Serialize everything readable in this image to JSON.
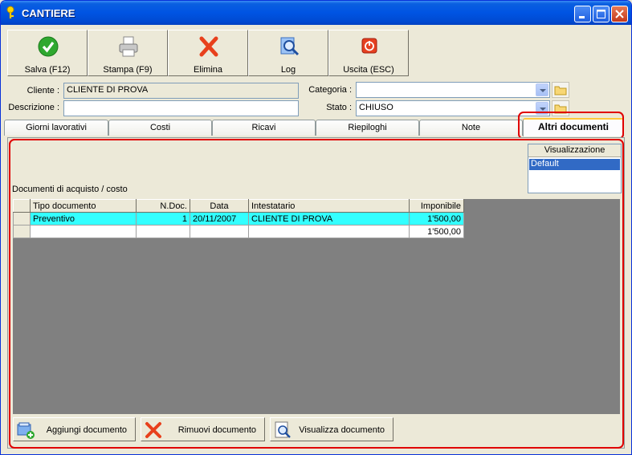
{
  "window": {
    "title": "CANTIERE"
  },
  "toolbar": {
    "save_label": "Salva (F12)",
    "print_label": "Stampa (F9)",
    "delete_label": "Elimina",
    "log_label": "Log",
    "exit_label": "Uscita (ESC)"
  },
  "form": {
    "cliente_label": "Cliente :",
    "cliente_value": "CLIENTE DI PROVA",
    "descrizione_label": "Descrizione :",
    "descrizione_value": "",
    "categoria_label": "Categoria :",
    "categoria_value": "",
    "stato_label": "Stato :",
    "stato_value": "CHIUSO"
  },
  "tabs": [
    {
      "label": "Giorni lavorativi"
    },
    {
      "label": "Costi"
    },
    {
      "label": "Ricavi"
    },
    {
      "label": "Riepiloghi"
    },
    {
      "label": "Note"
    },
    {
      "label": "Altri documenti"
    }
  ],
  "visualizzazione": {
    "header": "Visualizzazione",
    "selected": "Default"
  },
  "section_label": "Documenti di acquisto / costo",
  "grid": {
    "columns": [
      "Tipo documento",
      "N.Doc.",
      "Data",
      "Intestatario",
      "Imponibile"
    ],
    "rows": [
      {
        "tipo": "Preventivo",
        "ndoc": "1",
        "data": "20/11/2007",
        "intestatario": "CLIENTE DI PROVA",
        "imponibile": "1'500,00"
      }
    ],
    "total": "1'500,00"
  },
  "actions": {
    "add_label": "Aggiungi documento",
    "remove_label": "Rimuovi documento",
    "view_label": "Visualizza documento"
  },
  "colors": {
    "accent": "#0054E3",
    "highlight": "#E00000",
    "row_selected": "#33FFFF"
  }
}
